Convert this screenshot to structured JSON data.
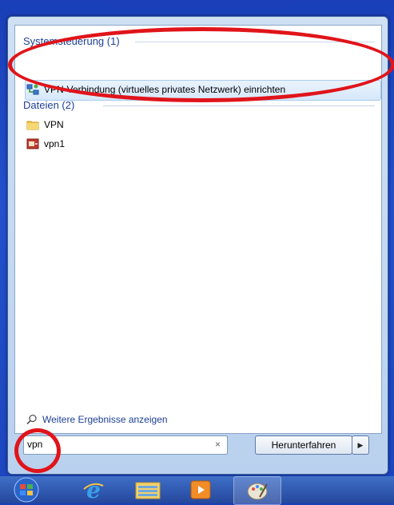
{
  "results": {
    "group_control_panel": "Systemsteuerung (1)",
    "control_panel_items": [
      "VPN-Verbindung (virtuelles privates Netzwerk) einrichten"
    ],
    "group_files": "Dateien (2)",
    "file_items": [
      "VPN",
      "vpn1"
    ],
    "more_results": "Weitere Ergebnisse anzeigen"
  },
  "search": {
    "value": "vpn",
    "clear_icon": "×"
  },
  "shutdown": {
    "label": "Herunterfahren",
    "arrow": "▶"
  },
  "colors": {
    "accent": "#1c3f95",
    "annotation_red": "#e0141a",
    "desktop_blue": "#1a3fb8"
  },
  "icons": {
    "start": "windows-orb-icon",
    "ie": "internet-explorer-icon",
    "explorer": "folder-icon",
    "media": "media-player-icon",
    "paint": "paint-icon"
  }
}
